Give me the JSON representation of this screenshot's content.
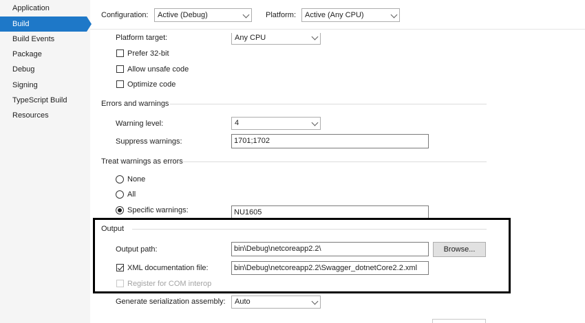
{
  "sidebar": {
    "items": [
      {
        "label": "Application"
      },
      {
        "label": "Build"
      },
      {
        "label": "Build Events"
      },
      {
        "label": "Package"
      },
      {
        "label": "Debug"
      },
      {
        "label": "Signing"
      },
      {
        "label": "TypeScript Build"
      },
      {
        "label": "Resources"
      }
    ],
    "selected": "Build"
  },
  "toolbar": {
    "configuration_label": "Configuration:",
    "configuration_value": "Active (Debug)",
    "platform_label": "Platform:",
    "platform_value": "Active (Any CPU)"
  },
  "general": {
    "platform_target_label": "Platform target:",
    "platform_target_value": "Any CPU",
    "prefer32_label": "Prefer 32-bit",
    "prefer32_checked": false,
    "unsafe_label": "Allow unsafe code",
    "unsafe_checked": false,
    "optimize_label": "Optimize code",
    "optimize_checked": false
  },
  "errors": {
    "header": "Errors and warnings",
    "warning_level_label": "Warning level:",
    "warning_level_value": "4",
    "suppress_label": "Suppress warnings:",
    "suppress_value": "1701;1702"
  },
  "treat": {
    "header": "Treat warnings as errors",
    "none_label": "None",
    "all_label": "All",
    "specific_label": "Specific warnings:",
    "specific_value": "NU1605",
    "selected": "Specific warnings:"
  },
  "output": {
    "header": "Output",
    "path_label": "Output path:",
    "path_value": "bin\\Debug\\netcoreapp2.2\\",
    "browse_label": "Browse...",
    "xml_label": "XML documentation file:",
    "xml_checked": true,
    "xml_value": "bin\\Debug\\netcoreapp2.2\\Swagger_dotnetCore2.2.xml",
    "com_label": "Register for COM interop",
    "com_checked": false,
    "serialization_label": "Generate serialization assembly:",
    "serialization_value": "Auto"
  },
  "colors": {
    "selection": "#1e78c8",
    "sidebar_bg": "#f5f5f5",
    "highlight_border": "#000000"
  }
}
